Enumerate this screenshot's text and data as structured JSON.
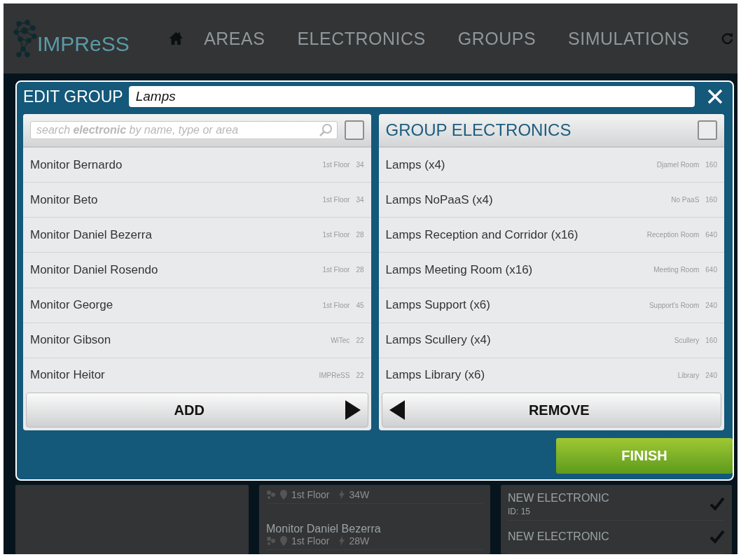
{
  "nav": {
    "logo": "IMPReSS",
    "items": [
      {
        "label": "AREAS"
      },
      {
        "label": "ELECTRONICS"
      },
      {
        "label": "GROUPS"
      },
      {
        "label": "SIMULATIONS"
      }
    ]
  },
  "dialog": {
    "title": "EDIT GROUP",
    "name_field": {
      "value": "Lamps"
    },
    "available": {
      "search": {
        "placeholder": "search **electronic** by name, type or area"
      },
      "select_all_checked": false,
      "button": "ADD",
      "items": [
        {
          "name": "Monitor Bernardo",
          "area": "1st Floor",
          "power": "34"
        },
        {
          "name": "Monitor Beto",
          "area": "1st Floor",
          "power": "34"
        },
        {
          "name": "Monitor Daniel Bezerra",
          "area": "1st Floor",
          "power": "28"
        },
        {
          "name": "Monitor Daniel Rosendo",
          "area": "1st Floor",
          "power": "28"
        },
        {
          "name": "Monitor George",
          "area": "1st Floor",
          "power": "45"
        },
        {
          "name": "Monitor Gibson",
          "area": "WiTec",
          "power": "22"
        },
        {
          "name": "Monitor Heitor",
          "area": "IMPReSS",
          "power": "22"
        }
      ]
    },
    "group": {
      "title": "GROUP ELECTRONICS",
      "select_all_checked": false,
      "button": "REMOVE",
      "items": [
        {
          "name": "Lamps (x4)",
          "area": "Djamel Room",
          "power": "160"
        },
        {
          "name": "Lamps NoPaaS (x4)",
          "area": "No PaaS",
          "power": "160"
        },
        {
          "name": "Lamps Reception and Corridor (x16)",
          "area": "Reception Room",
          "power": "640"
        },
        {
          "name": "Lamps Meeting Room (x16)",
          "area": "Meeting Room",
          "power": "640"
        },
        {
          "name": "Lamps Support (x6)",
          "area": "Support's Room",
          "power": "240"
        },
        {
          "name": "Lamps Scullery (x4)",
          "area": "Scullery",
          "power": "160"
        },
        {
          "name": "Lamps Library (x6)",
          "area": "Library",
          "power": "240"
        }
      ]
    },
    "finish_button": "FINISH"
  },
  "background": {
    "electronics": [
      {
        "area": "1st Floor",
        "power": "34W"
      },
      {
        "name": "Monitor Daniel Bezerra",
        "area": "1st Floor",
        "power": "28W"
      }
    ],
    "new_items": [
      {
        "title": "NEW ELECTRONIC",
        "id": "ID: 15",
        "checked": true
      },
      {
        "title": "NEW ELECTRONIC",
        "checked": true
      }
    ]
  }
}
